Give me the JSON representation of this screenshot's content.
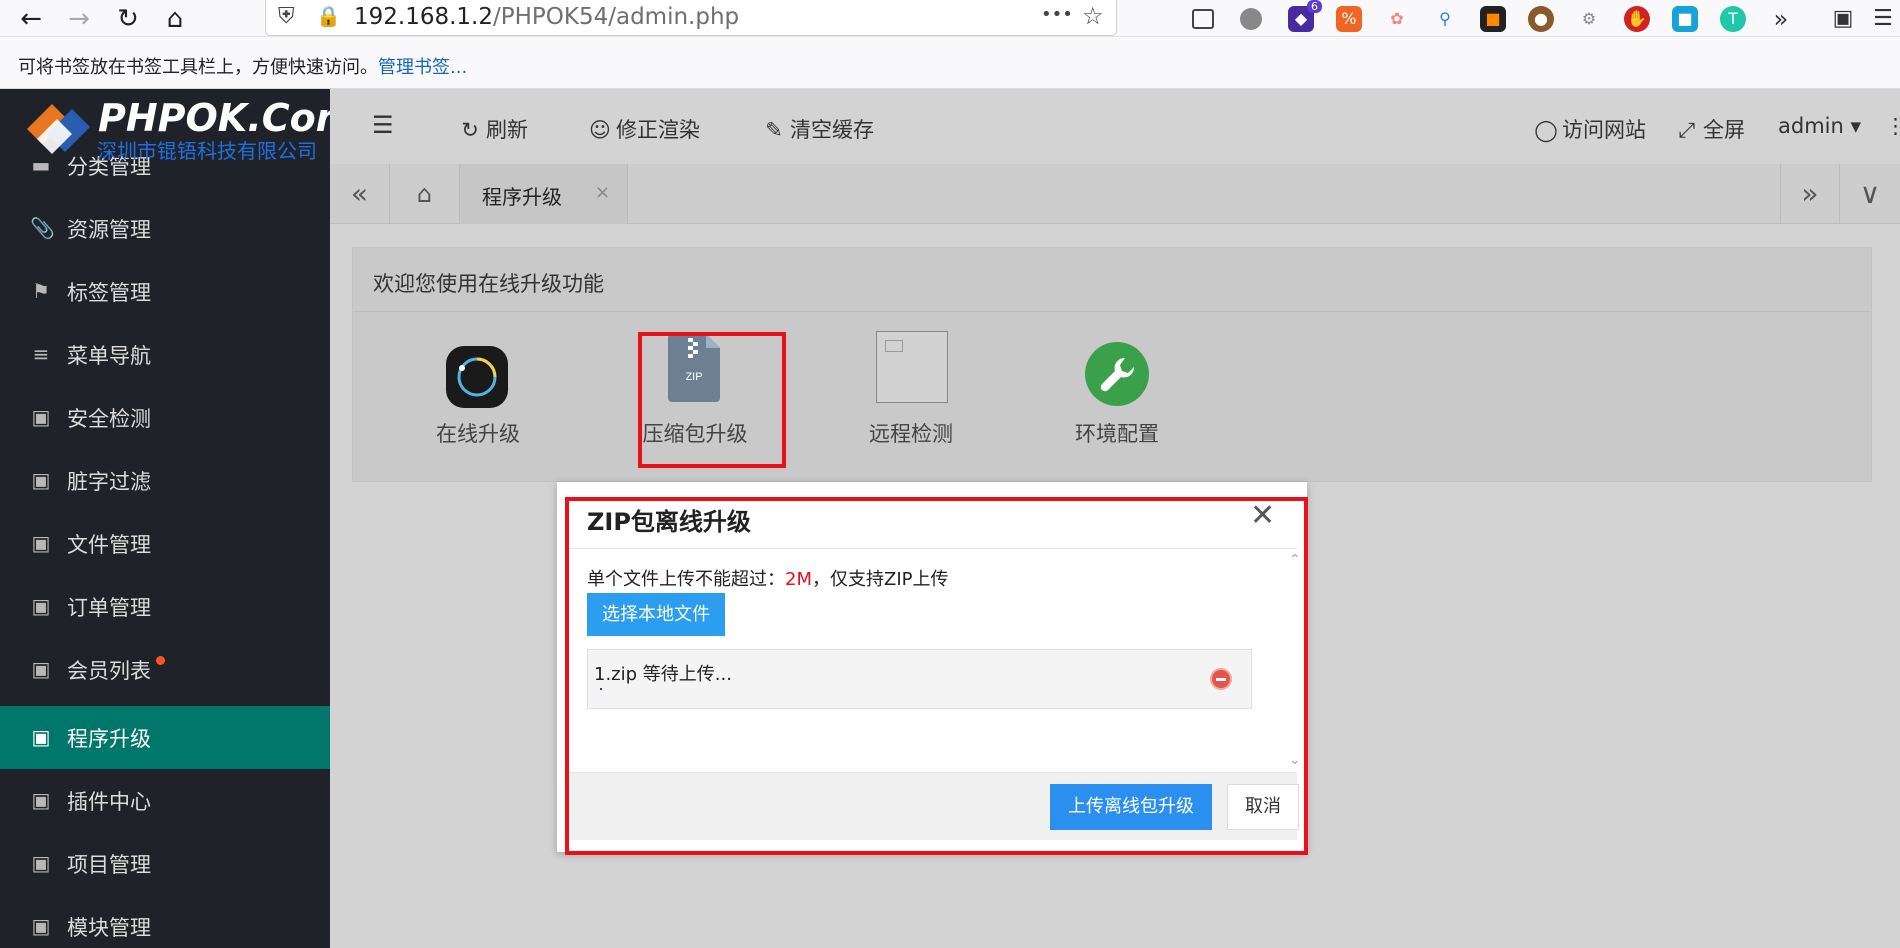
{
  "browser": {
    "url_main": "192.168.1.2",
    "url_path": "/PHPOK54/admin.php",
    "url_menu": "•••",
    "bookmarks_hint": "可将书签放在书签工具栏上，方便快速访问。",
    "bookmarks_link": "管理书签...",
    "ext_badge": "6"
  },
  "logo": {
    "title": "PHPOK.Com",
    "subtitle": "深圳市锟铻科技有限公司"
  },
  "sidebar": {
    "items": [
      {
        "label": "分类管理",
        "icon": "folder-icon"
      },
      {
        "label": "资源管理",
        "icon": "paperclip-icon"
      },
      {
        "label": "标签管理",
        "icon": "tag-icon"
      },
      {
        "label": "菜单导航",
        "icon": "list-icon"
      },
      {
        "label": "安全检测",
        "icon": "external-icon"
      },
      {
        "label": "脏字过滤",
        "icon": "external-icon"
      },
      {
        "label": "文件管理",
        "icon": "external-icon"
      },
      {
        "label": "订单管理",
        "icon": "external-icon"
      },
      {
        "label": "会员列表",
        "icon": "external-icon"
      },
      {
        "label": "程序升级",
        "icon": "external-icon"
      },
      {
        "label": "插件中心",
        "icon": "external-icon"
      },
      {
        "label": "项目管理",
        "icon": "external-icon"
      },
      {
        "label": "模块管理",
        "icon": "external-icon"
      }
    ]
  },
  "header": {
    "refresh": "刷新",
    "fix_render": "修正渲染",
    "clear_cache": "清空缓存",
    "visit_site": "访问网站",
    "fullscreen": "全屏",
    "user": "admin"
  },
  "tabs": {
    "active": "程序升级"
  },
  "card": {
    "title": "欢迎您使用在线升级功能",
    "tools": [
      {
        "label": "在线升级"
      },
      {
        "label": "压缩包升级"
      },
      {
        "label": "远程检测"
      },
      {
        "label": "环境配置"
      }
    ]
  },
  "modal": {
    "title": "ZIP包离线升级",
    "limit_prefix": "单个文件上传不能超过：",
    "limit_value": "2M",
    "limit_suffix": "，仅支持ZIP上传",
    "choose_button": "选择本地文件",
    "file_status": "1.zip 等待上传...",
    "upload_button": "上传离线包升级",
    "cancel_button": "取消"
  },
  "colors": {
    "sidebar_bg": "#20222a",
    "sidebar_active": "#00776a",
    "primary_button": "#2b8ff0",
    "highlight_red": "#e8101a",
    "notify_dot": "#ff5722"
  }
}
